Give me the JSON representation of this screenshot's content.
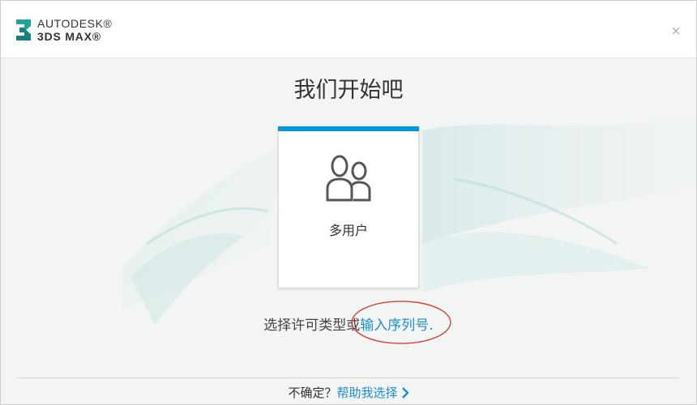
{
  "header": {
    "brand_line1": "AUTODESK®",
    "brand_line2": "3DS MAX®",
    "logo_mark": "3",
    "close_glyph": "×"
  },
  "title": "我们开始吧",
  "card": {
    "label": "多用户",
    "icon": "multi-user-icon",
    "accent_color": "#0696d7"
  },
  "license": {
    "prefix": "选择许可类型或",
    "link": "输入序列号",
    "suffix": "."
  },
  "footer": {
    "question": "不确定？",
    "link": "帮助我选择"
  },
  "colors": {
    "link": "#1a8fd1",
    "annotation": "#d9342b"
  }
}
